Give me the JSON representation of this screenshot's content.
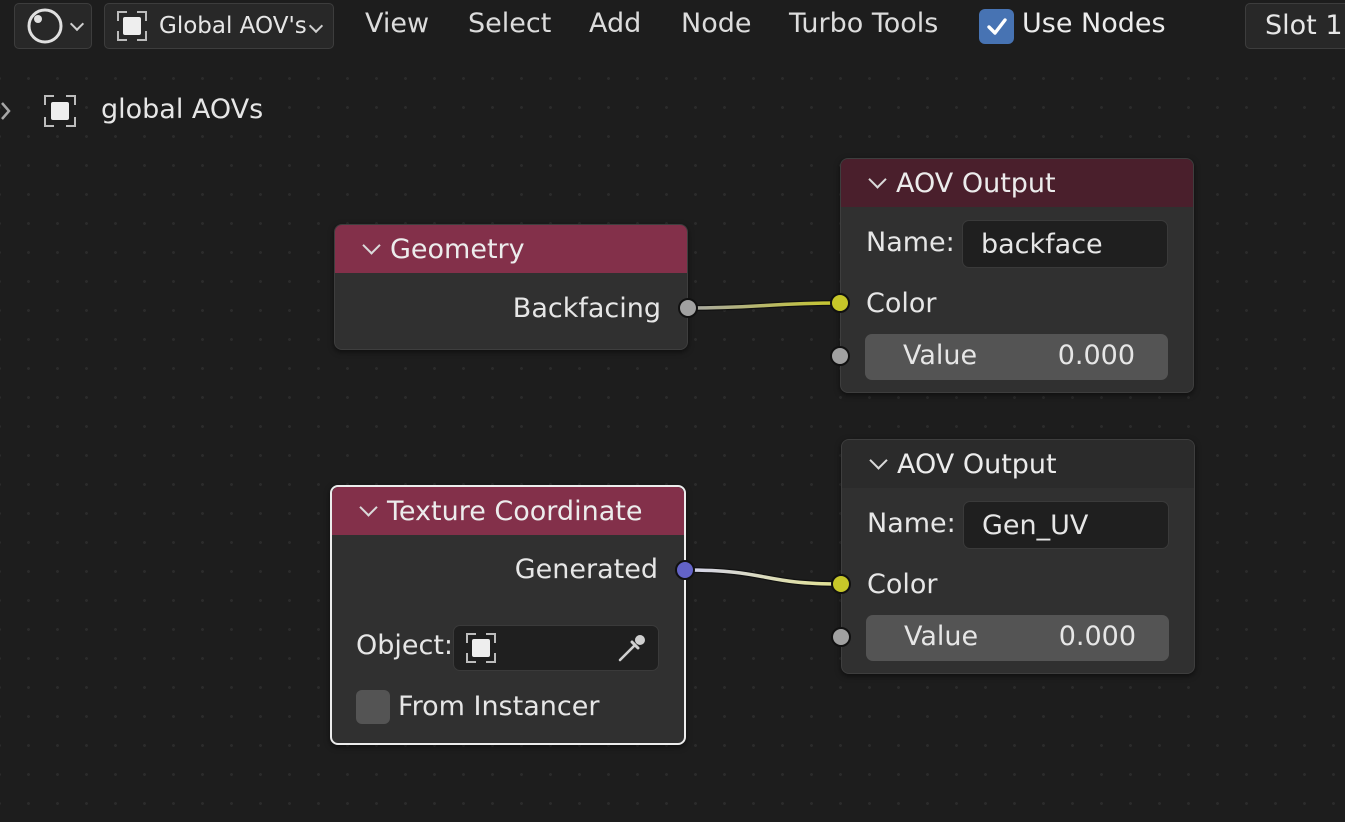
{
  "header": {
    "node_tree_name": "Global AOV's",
    "menu": [
      "View",
      "Select",
      "Add",
      "Node",
      "Turbo Tools"
    ],
    "use_nodes_label": "Use Nodes",
    "use_nodes_checked": true,
    "slot_label": "Slot 1"
  },
  "breadcrumb": {
    "label": "global AOVs"
  },
  "nodes": {
    "geometry": {
      "title": "Geometry",
      "output": "Backfacing",
      "header_color": "#83304a"
    },
    "texcoord": {
      "title": "Texture Coordinate",
      "output": "Generated",
      "object_label": "Object:",
      "object_value": "",
      "from_instancer_label": "From Instancer",
      "from_instancer_checked": false,
      "header_color": "#83304a"
    },
    "aov1": {
      "title": "AOV Output",
      "name_label": "Name:",
      "name_value": "backface",
      "color_label": "Color",
      "value_label": "Value",
      "value": "0.000",
      "header_color": "#4a1f2c"
    },
    "aov2": {
      "title": "AOV Output",
      "name_label": "Name:",
      "name_value": "Gen_UV",
      "color_label": "Color",
      "value_label": "Value",
      "value": "0.000",
      "header_color": "#2b2b2b"
    }
  },
  "colors": {
    "background": "#1d1d1d",
    "node_body": "#303030",
    "socket_float": "#a1a1a1",
    "socket_color": "#c7c729",
    "socket_vector": "#6363c7",
    "checkbox_accent": "#4773b3"
  },
  "icons": [
    "shading-sphere-icon",
    "object-icon",
    "eyedropper-icon",
    "checkmark-icon",
    "chevron-down-icon",
    "expand-arrow-icon"
  ]
}
